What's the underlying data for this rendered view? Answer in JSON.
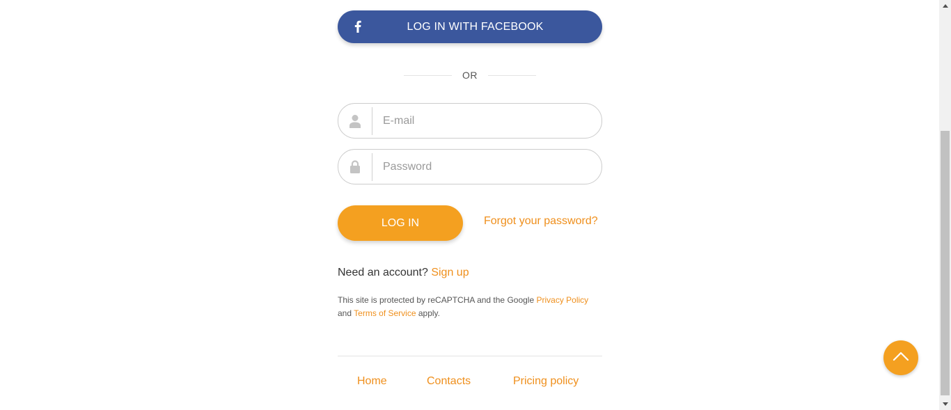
{
  "facebook_button": {
    "label": "LOG IN WITH FACEBOOK",
    "icon": "facebook-icon",
    "color": "#3b579d"
  },
  "divider": {
    "text": "OR"
  },
  "email_input": {
    "placeholder": "E-mail",
    "value": "",
    "icon": "user-icon"
  },
  "password_input": {
    "placeholder": "Password",
    "value": "",
    "icon": "lock-icon"
  },
  "login_button": {
    "label": "LOG IN",
    "color": "#f4a020"
  },
  "forgot_link": {
    "label": "Forgot your password?"
  },
  "signup_prompt": {
    "text": "Need an account?",
    "link_label": "Sign up"
  },
  "recaptcha": {
    "text_before": "This site is protected by reCAPTCHA and the Google",
    "privacy_label": "Privacy Policy",
    "and_text": "and",
    "terms_label": "Terms of Service",
    "apply_text": "apply."
  },
  "footer": {
    "links": [
      {
        "label": "Home"
      },
      {
        "label": "Contacts"
      },
      {
        "label": "Pricing policy"
      }
    ]
  },
  "scroll_top": {
    "icon": "chevron-up-icon"
  },
  "colors": {
    "accent": "#f4a020",
    "link": "#ef8f1c",
    "facebook": "#3b579d"
  }
}
